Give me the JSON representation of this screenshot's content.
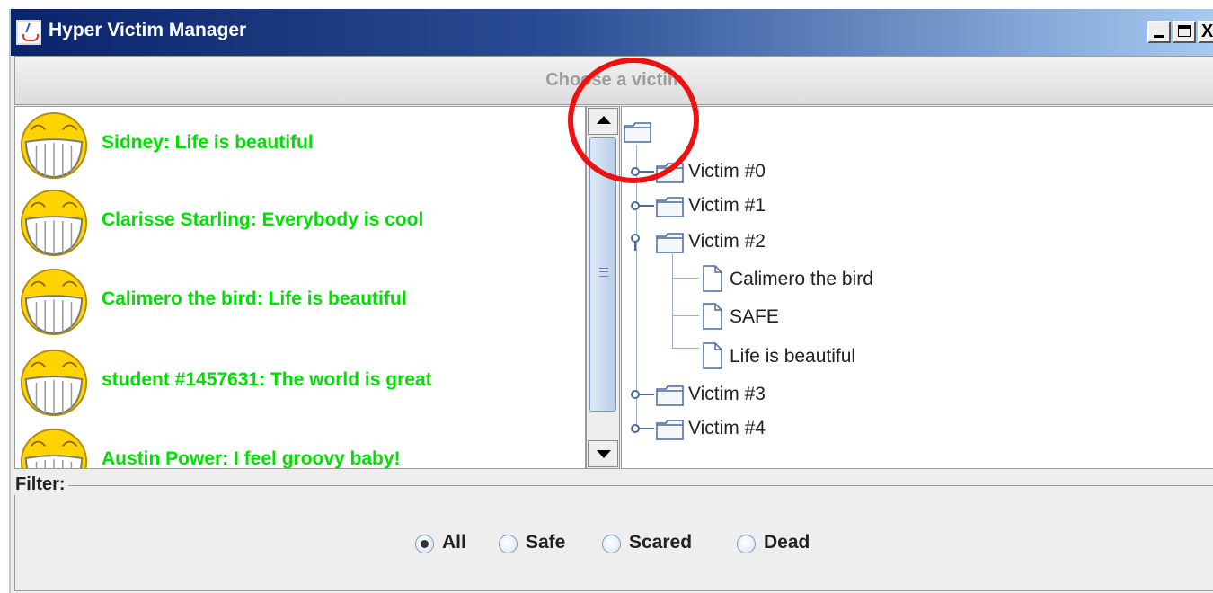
{
  "window": {
    "title": "Hyper Victim Manager",
    "controls": {
      "minimize": "_",
      "maximize": "□",
      "close": "X"
    }
  },
  "header": {
    "label": "Choose a victim"
  },
  "messages": [
    {
      "text": "Sidney: Life is beautiful",
      "icon": "laughing-smiley-icon"
    },
    {
      "text": "Clarisse Starling: Everybody is cool",
      "icon": "laughing-smiley-icon"
    },
    {
      "text": "Calimero the bird: Life is beautiful",
      "icon": "laughing-smiley-icon"
    },
    {
      "text": "student #1457631: The world is great",
      "icon": "laughing-smiley-icon"
    },
    {
      "text": "Austin Power: I feel groovy baby!",
      "icon": "laughing-smiley-icon"
    }
  ],
  "tree": {
    "victims": [
      {
        "label": "Victim #0",
        "expanded": false
      },
      {
        "label": "Victim #1",
        "expanded": false
      },
      {
        "label": "Victim #2",
        "expanded": true,
        "children": [
          "Calimero the bird",
          "SAFE",
          "Life is beautiful"
        ]
      },
      {
        "label": "Victim #3",
        "expanded": false
      },
      {
        "label": "Victim #4",
        "expanded": false
      }
    ]
  },
  "filter": {
    "title": "Filter:",
    "options": [
      {
        "label": "All",
        "selected": true
      },
      {
        "label": "Safe",
        "selected": false
      },
      {
        "label": "Scared",
        "selected": false
      },
      {
        "label": "Dead",
        "selected": false
      }
    ]
  },
  "colors": {
    "message_text": "#00e000",
    "titlebar_start": "#0a246a",
    "titlebar_end": "#a6caf0",
    "annotation": "#ee1111"
  }
}
